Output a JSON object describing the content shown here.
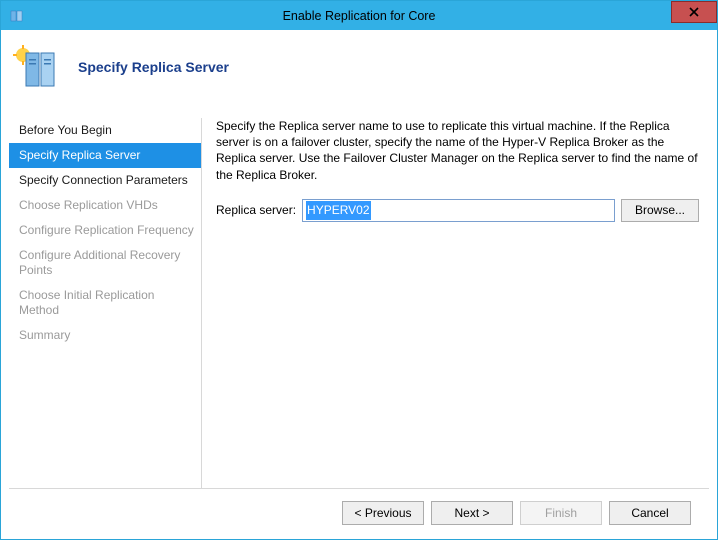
{
  "window": {
    "title": "Enable Replication for Core"
  },
  "header": {
    "title": "Specify Replica Server"
  },
  "sidebar": {
    "items": [
      {
        "label": "Before You Begin",
        "state": "normal"
      },
      {
        "label": "Specify Replica Server",
        "state": "selected"
      },
      {
        "label": "Specify Connection Parameters",
        "state": "normal"
      },
      {
        "label": "Choose Replication VHDs",
        "state": "disabled"
      },
      {
        "label": "Configure Replication Frequency",
        "state": "disabled"
      },
      {
        "label": "Configure Additional Recovery Points",
        "state": "disabled"
      },
      {
        "label": "Choose Initial Replication Method",
        "state": "disabled"
      },
      {
        "label": "Summary",
        "state": "disabled"
      }
    ]
  },
  "main": {
    "description": "Specify the Replica server name to use to replicate this virtual machine. If the Replica server is on a failover cluster, specify the name of the Hyper-V Replica Broker as the Replica server. Use the Failover Cluster Manager on the Replica server to find the name of the Replica Broker.",
    "field_label": "Replica server:",
    "field_value": "HYPERV02",
    "browse_label": "Browse..."
  },
  "footer": {
    "previous": "< Previous",
    "next": "Next >",
    "finish": "Finish",
    "cancel": "Cancel"
  }
}
